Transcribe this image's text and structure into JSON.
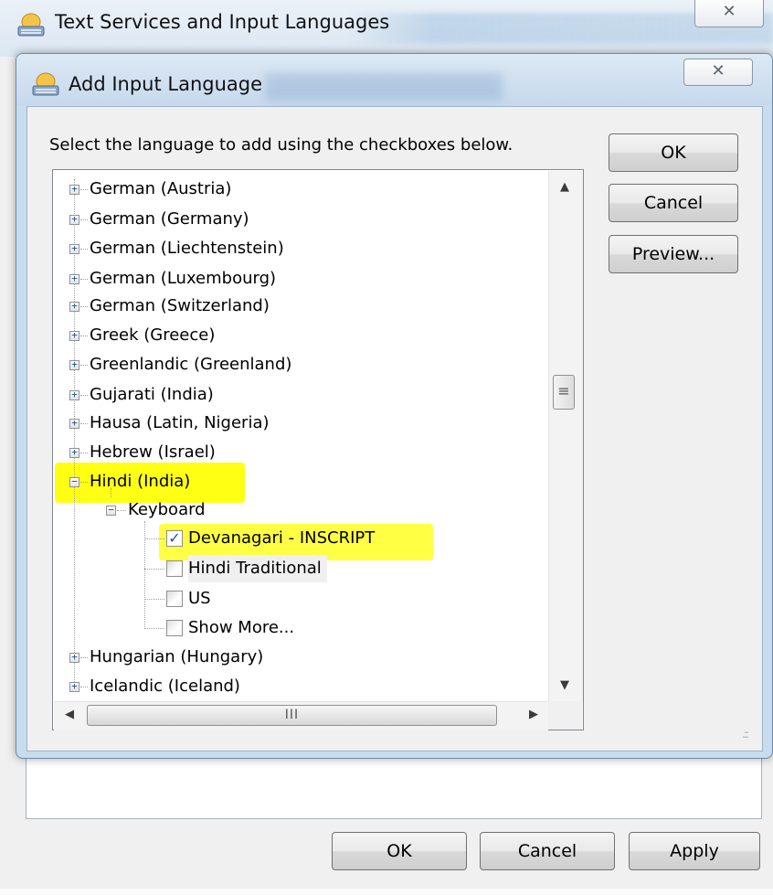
{
  "back_window": {
    "title": "Text Services and Input Languages",
    "close_glyph": "✕",
    "buttons": {
      "ok": "OK",
      "cancel": "Cancel",
      "apply": "Apply"
    }
  },
  "dialog": {
    "title": "Add Input Language",
    "close_glyph": "✕",
    "instruction": "Select the language to add using the checkboxes below.",
    "buttons": {
      "ok": "OK",
      "cancel": "Cancel",
      "preview": "Preview..."
    }
  },
  "tree": {
    "languages_before": [
      "German (Austria)",
      "German (Germany)",
      "German (Liechtenstein)",
      "German (Luxembourg)",
      "German (Switzerland)",
      "Greek (Greece)",
      "Greenlandic (Greenland)",
      "Gujarati (India)",
      "Hausa (Latin, Nigeria)",
      "Hebrew (Israel)"
    ],
    "expanded_language": "Hindi (India)",
    "category": "Keyboard",
    "layouts": [
      {
        "label": "Devanagari - INSCRIPT",
        "checked": true
      },
      {
        "label": "Hindi Traditional",
        "checked": false
      },
      {
        "label": "US",
        "checked": false
      },
      {
        "label": "Show More...",
        "checked": false
      }
    ],
    "languages_after": [
      "Hungarian (Hungary)",
      "Icelandic (Iceland)"
    ]
  },
  "scrollbar": {
    "up_arrow": "▲",
    "down_arrow": "▼",
    "left_arrow": "◀",
    "right_arrow": "▶",
    "v_grip": "≡",
    "h_grip": "III"
  },
  "colors": {
    "highlight": "#ffff00",
    "dialog_frame": "#c8dcef",
    "client_bg": "#f0f0f0"
  }
}
